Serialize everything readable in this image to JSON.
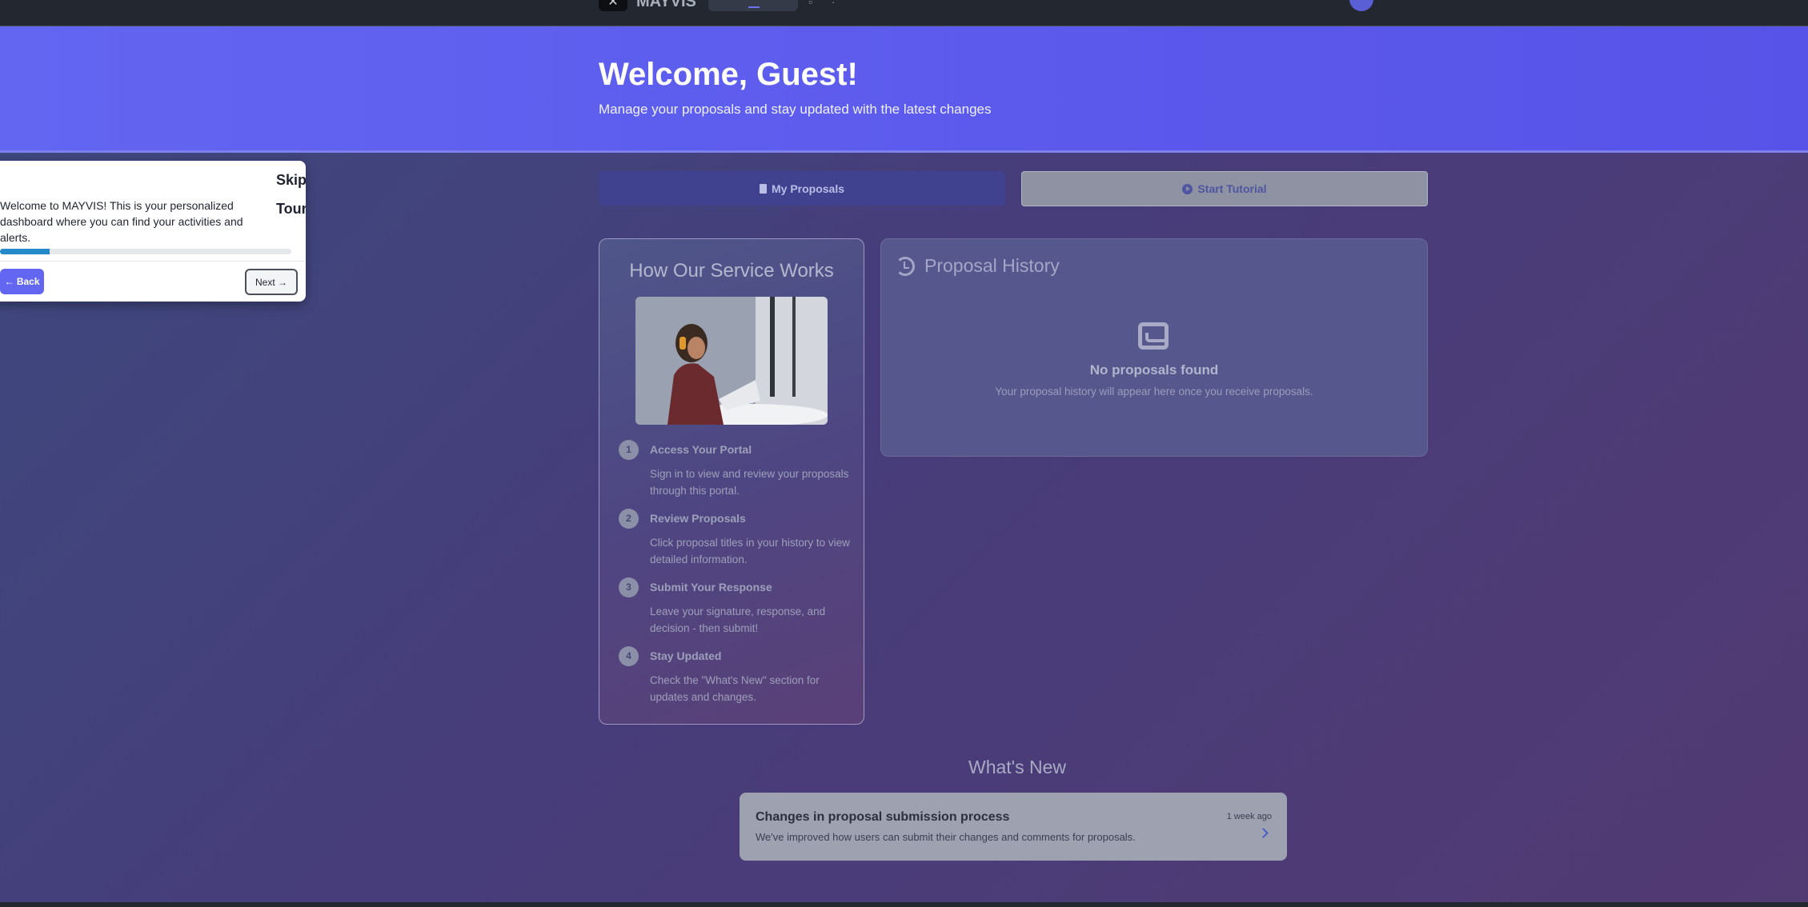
{
  "topbar": {
    "brand": "MAYVIS",
    "logo_icon": "x-logo-icon"
  },
  "hero": {
    "title": "Welcome, Guest!",
    "subtitle": "Manage your proposals and stay updated with the latest changes"
  },
  "actions": {
    "my_proposals": "My Proposals",
    "start_tutorial": "Start Tutorial"
  },
  "how_it_works": {
    "title": "How Our Service Works",
    "steps": [
      {
        "num": "1",
        "title": "Access Your Portal",
        "desc": "Sign in to view and review your proposals through this portal."
      },
      {
        "num": "2",
        "title": "Review Proposals",
        "desc": "Click proposal titles in your history to view detailed information."
      },
      {
        "num": "3",
        "title": "Submit Your Response",
        "desc": "Leave your signature, response, and decision - then submit!"
      },
      {
        "num": "4",
        "title": "Stay Updated",
        "desc": "Check the \"What's New\" section for updates and changes."
      }
    ]
  },
  "history": {
    "title": "Proposal History",
    "empty_title": "No proposals found",
    "empty_desc": "Your proposal history will appear here once you receive proposals."
  },
  "whats_new": {
    "title": "What's New",
    "items": [
      {
        "title": "Changes in proposal submission process",
        "desc": "We've improved how users can submit their changes and comments for proposals.",
        "time": "1 week ago"
      }
    ]
  },
  "tour": {
    "skip_label": "Skip Tour",
    "message": "Welcome to MAYVIS! This is your personalized dashboard where you can find your activities and alerts.",
    "progress": 0.17,
    "back_label": "← Back",
    "next_label": "Next →"
  },
  "colors": {
    "accent": "#6366f1",
    "progress": "#2489c9"
  }
}
